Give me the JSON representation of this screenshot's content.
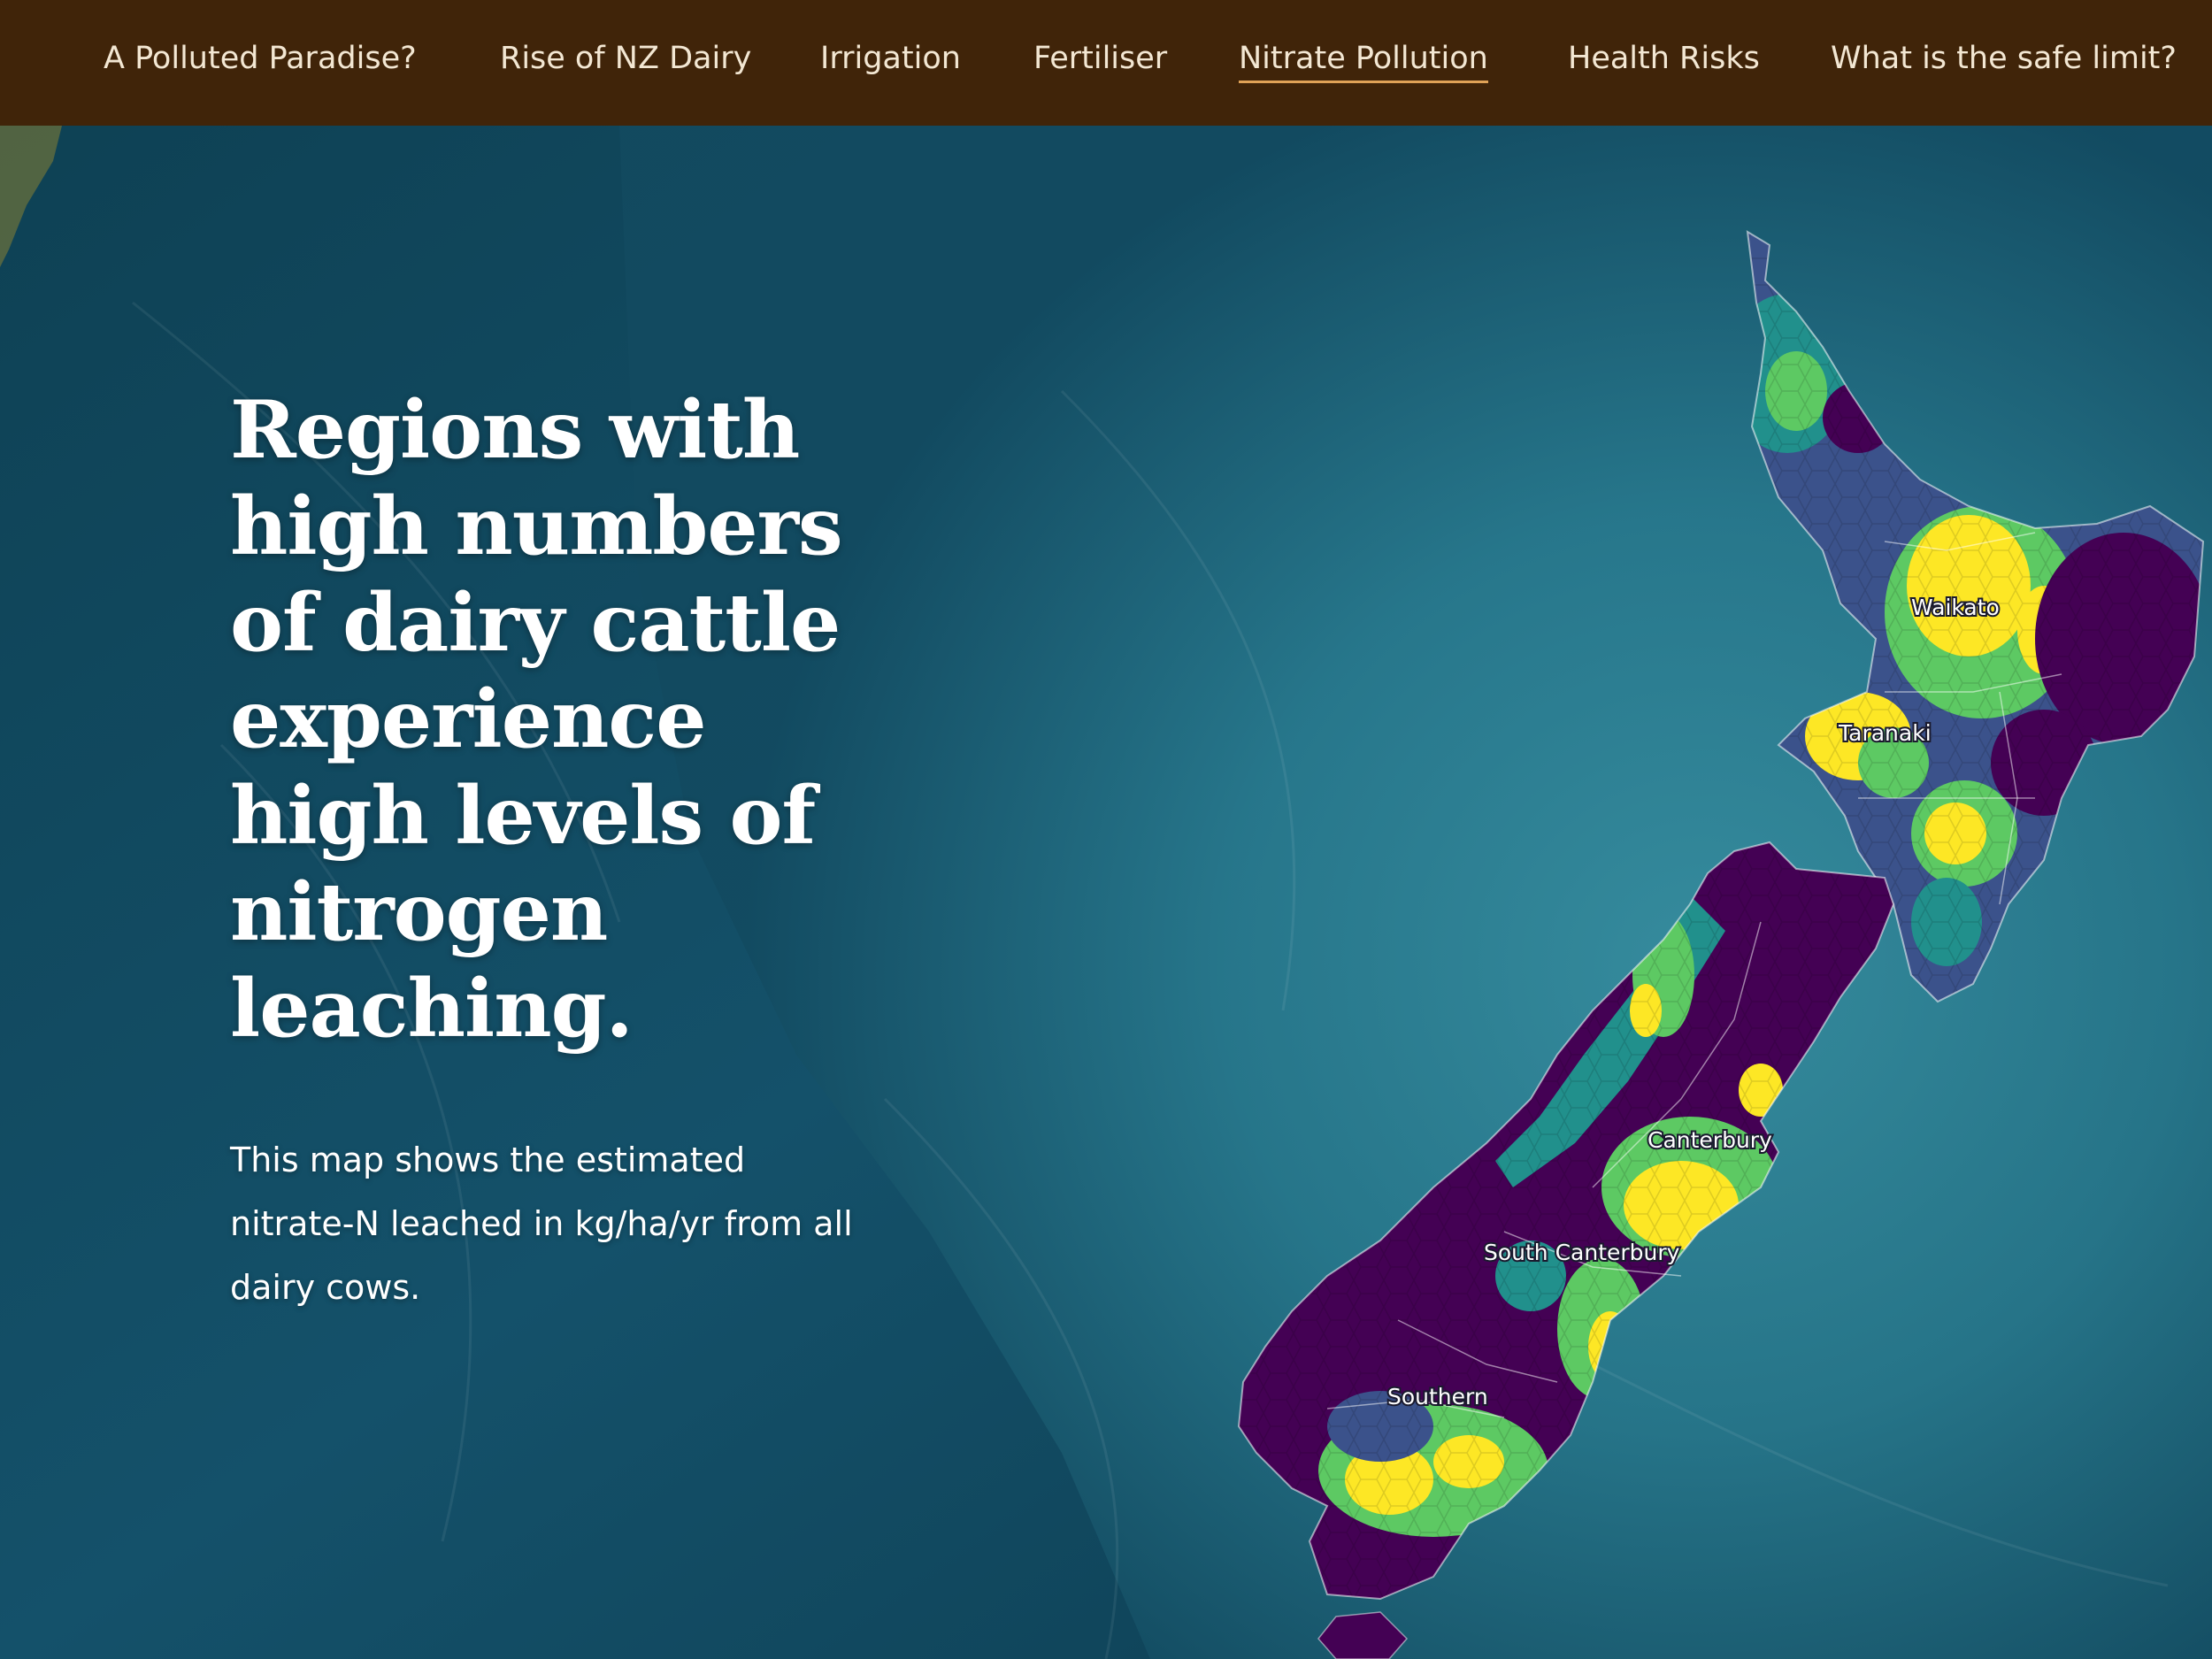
{
  "nav": {
    "items": [
      {
        "label": "A Polluted Paradise?"
      },
      {
        "label": "Rise of NZ Dairy"
      },
      {
        "label": "Irrigation"
      },
      {
        "label": "Fertiliser"
      },
      {
        "label": "Nitrate Pollution",
        "active": true
      },
      {
        "label": "Health Risks"
      },
      {
        "label": "What is the safe limit?"
      }
    ]
  },
  "main": {
    "headline": "Regions with high numbers of dairy cattle experience high levels of nitrogen leaching.",
    "description": "This map shows the estimated nitrate-N leached in kg/ha/yr from all dairy cows."
  },
  "map": {
    "region_labels": [
      "Waikato",
      "Taranaki",
      "Canterbury",
      "South Canterbury",
      "Southern"
    ],
    "colors": {
      "nav_bg": "#402409",
      "nav_active_underline": "#e0a257",
      "ocean_deep": "#0d3a4c",
      "ocean_shelf": "#2e8397",
      "hex_low": "#440154",
      "hex_mid_low": "#3b528b",
      "hex_mid": "#21908c",
      "hex_mid_high": "#5dc963",
      "hex_high": "#fde725"
    }
  }
}
